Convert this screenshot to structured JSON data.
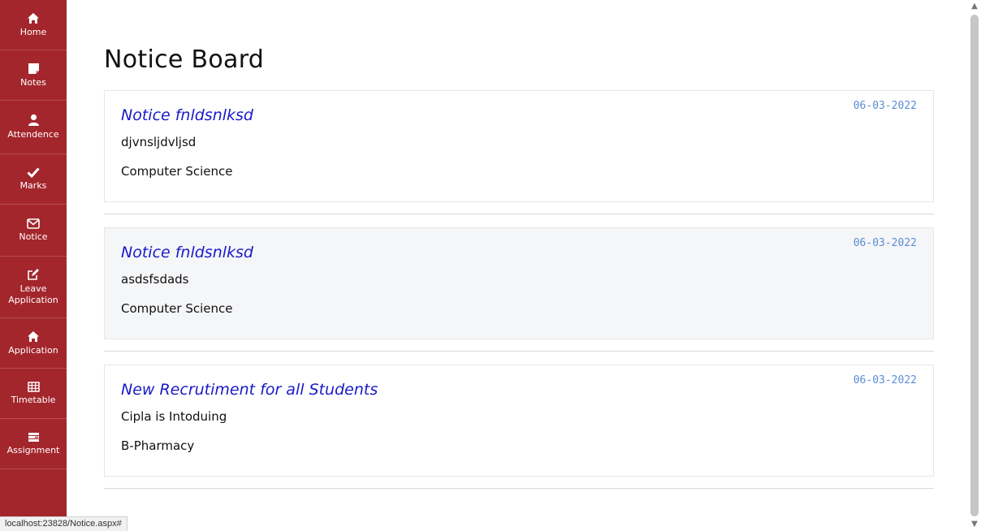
{
  "sidebar": {
    "items": [
      {
        "label": "Home",
        "icon": "home-icon"
      },
      {
        "label": "Notes",
        "icon": "note-icon"
      },
      {
        "label": "Attendence",
        "icon": "user-icon"
      },
      {
        "label": "Marks",
        "icon": "check-icon"
      },
      {
        "label": "Notice",
        "icon": "envelope-icon"
      },
      {
        "label_line1": "Leave",
        "label_line2": "Application",
        "icon": "edit-icon"
      },
      {
        "label": "Application",
        "icon": "home-icon"
      },
      {
        "label": "Timetable",
        "icon": "table-icon"
      },
      {
        "label": "Assignment",
        "icon": "tasks-icon"
      }
    ]
  },
  "page": {
    "title": "Notice Board"
  },
  "notices": [
    {
      "title": "Notice fnldsnlksd",
      "date": "06-03-2022",
      "body": "djvnsljdvljsd",
      "department": "Computer Science"
    },
    {
      "title": "Notice fnldsnlksd",
      "date": "06-03-2022",
      "body": "asdsfsdads",
      "department": "Computer Science"
    },
    {
      "title": "New Recrutiment for all Students",
      "date": "06-03-2022",
      "body": "Cipla is Intoduing",
      "department": "B-Pharmacy"
    }
  ],
  "status": {
    "url": "localhost:23828/Notice.aspx#"
  },
  "colors": {
    "sidebar_bg": "#a3262c",
    "notice_title": "#1a1ac8",
    "date": "#5b8dd6"
  }
}
